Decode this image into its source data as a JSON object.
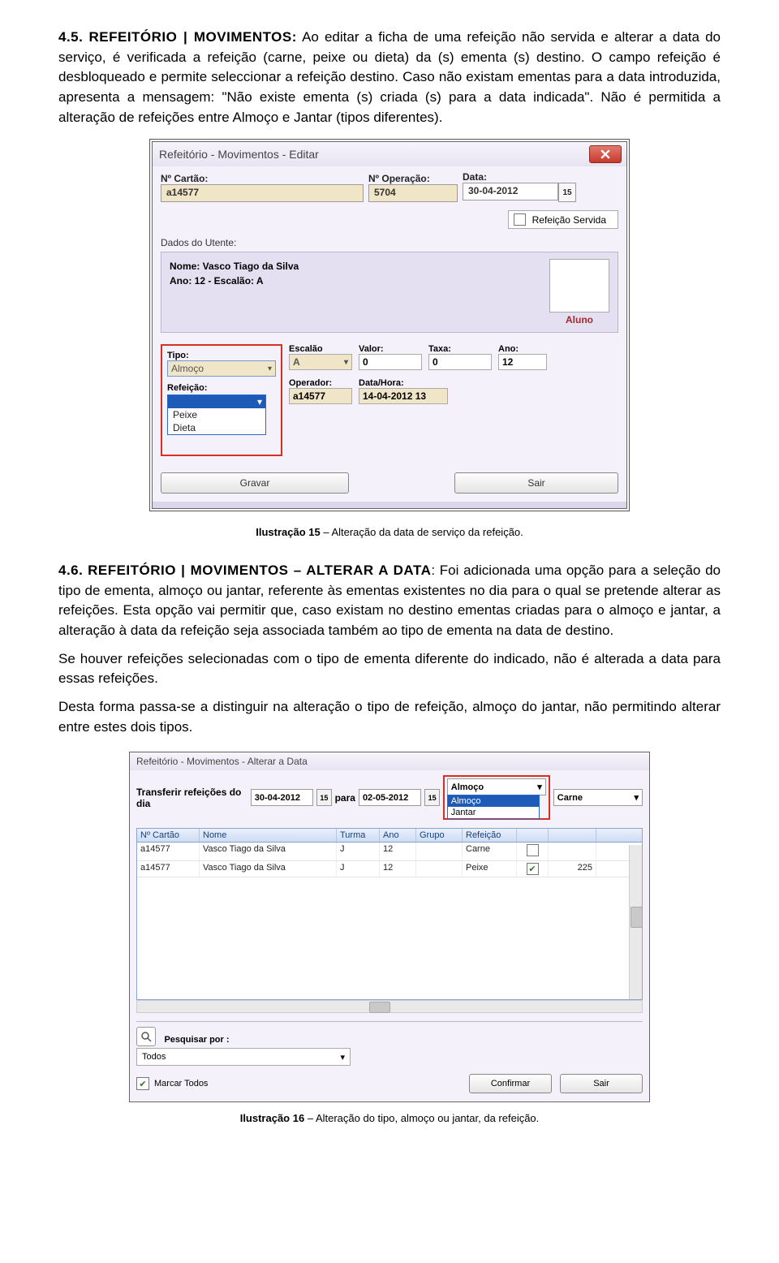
{
  "sections": {
    "s45": {
      "num": "4.5.",
      "lead": "REFEITÓRIO | MOVIMENTOS:",
      "text": " Ao editar a ficha de uma refeição não servida e alterar a data do serviço, é verificada a refeição (carne, peixe ou dieta) da (s) ementa (s) destino. O campo refeição é desbloqueado e permite seleccionar a refeição destino. Caso não existam ementas para a data introduzida, apresenta a mensagem: \"Não existe ementa (s) criada (s) para a data indicada\". Não é permitida a alteração de refeições entre Almoço e Jantar (tipos diferentes)."
    },
    "s46": {
      "num": "4.6.",
      "lead": "REFEITÓRIO | MOVIMENTOS – ALTERAR A DATA",
      "text": ": Foi adicionada uma opção para a seleção do tipo de ementa, almoço ou jantar, referente às ementas existentes no dia para o qual se pretende alterar as refeições. Esta opção vai permitir que, caso existam no destino ementas criadas para o almoço e jantar, a alteração à data da refeição seja associada também ao tipo de ementa na data de destino.",
      "text2": "Se houver refeições selecionadas com o tipo de ementa diferente do indicado, não é alterada a data para essas refeições.",
      "text3": "Desta forma passa-se a distinguir na alteração o tipo de refeição, almoço do jantar, não permitindo alterar entre estes dois tipos."
    }
  },
  "captions": {
    "c15b": "Ilustração 15",
    "c15t": " – Alteração da data de serviço da refeição.",
    "c16b": "Ilustração 16",
    "c16t": " – Alteração do tipo, almoço ou jantar, da refeição."
  },
  "shot1": {
    "title": "Refeitório - Movimentos - Editar",
    "labels": {
      "nCartao": "Nº Cartão:",
      "nOper": "Nº Operação:",
      "data": "Data:",
      "servida": "Refeição Servida",
      "dados": "Dados do Utente:",
      "nome": "Nome: Vasco Tiago da Silva",
      "anoEsc": "Ano: 12  -  Escalão: A",
      "aluno": "Aluno",
      "tipo": "Tipo:",
      "escalao": "Escalão",
      "valor": "Valor:",
      "taxa": "Taxa:",
      "ano2": "Ano:",
      "refeicao": "Refeição:",
      "operador": "Operador:",
      "datahora": "Data/Hora:",
      "gravar": "Gravar",
      "sair": "Sair"
    },
    "vals": {
      "nCartao": "a14577",
      "nOper": "5704",
      "data": "30-04-2012",
      "tipo": "Almoço",
      "escalao": "A",
      "valor": "0",
      "taxa": "0",
      "ano2": "12",
      "operador": "a14577",
      "datahora": "14-04-2012 13",
      "opt1": "Peixe",
      "opt2": "Dieta"
    }
  },
  "shot2": {
    "title": "Refeitório - Movimentos - Alterar a Data",
    "top": {
      "transf": "Transferir refeições do dia",
      "d1": "30-04-2012",
      "para": "para",
      "d2": "02-05-2012",
      "sel1": "Almoço",
      "sel1_hi": "Almoço",
      "sel1_o2": "Jantar",
      "sel2": "Carne"
    },
    "thead": {
      "c1": "Nº Cartão",
      "c2": "Nome",
      "c3": "Turma",
      "c4": "Ano",
      "c5": "Grupo",
      "c6": "Refeição"
    },
    "rows": [
      {
        "card": "a14577",
        "name": "Vasco Tiago da Silva",
        "turma": "J",
        "ano": "12",
        "grupo": "",
        "ref": "Carne",
        "chk": false,
        "price": ""
      },
      {
        "card": "a14577",
        "name": "Vasco Tiago da Silva",
        "turma": "J",
        "ano": "12",
        "grupo": "",
        "ref": "Peixe",
        "chk": true,
        "price": "225"
      }
    ],
    "bottom": {
      "pesq": "Pesquisar por :",
      "todos": "Todos",
      "marcar": "Marcar Todos",
      "confirmar": "Confirmar",
      "sair": "Sair"
    }
  }
}
